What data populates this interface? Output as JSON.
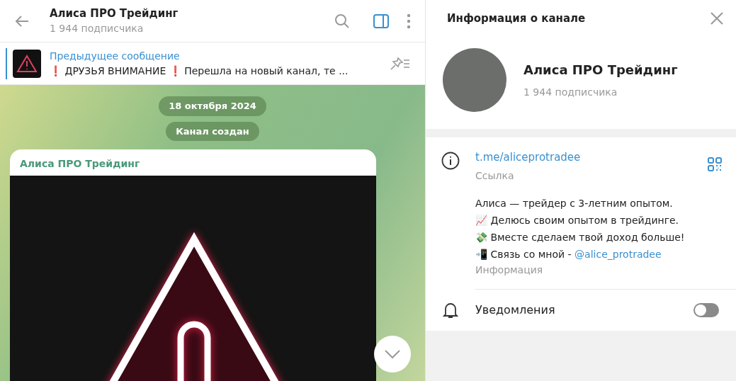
{
  "chat_header": {
    "title": "Алиса ПРО Трейдинг",
    "subtitle": "1 944 подписчика",
    "side_panel_open": true
  },
  "pinned": {
    "title": "Предыдущее сообщение",
    "text": "❗ ДРУЗЬЯ ВНИМАНИЕ ❗  Перешла на новый канал, те ..."
  },
  "service_messages": [
    "18 октября 2024",
    "Канал создан"
  ],
  "message": {
    "sender": "Алиса ПРО Трейдинг"
  },
  "info_panel": {
    "title": "Информация о канале",
    "name": "Алиса ПРО Трейдинг",
    "subtitle": "1 944 подписчика",
    "link": {
      "value": "t.me/aliceprotradee",
      "label": "Ссылка"
    },
    "bio": {
      "text": "Алиса — трейдер с 3-летним опытом.\n📈 Делюсь своим опытом в трейдинге.\n💸 Вместе сделаем твой доход больше!\n📲 Связь со мной - ",
      "mention": "@alice_protradee",
      "label": "Информация"
    },
    "notifications": {
      "label": "Уведомления",
      "on": false
    }
  }
}
